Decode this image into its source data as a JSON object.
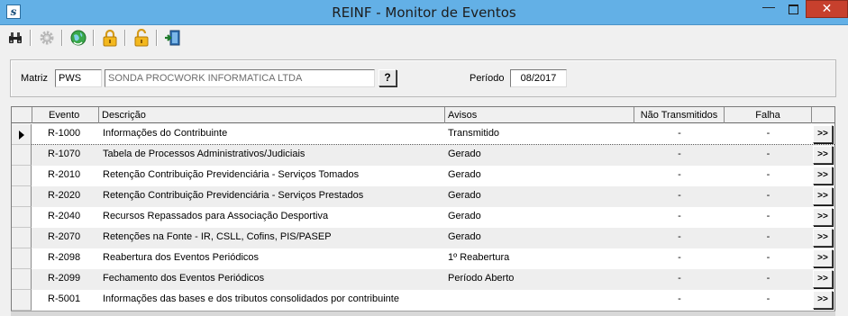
{
  "window": {
    "title": "REINF - Monitor de Eventos",
    "app_icon": "s",
    "close_glyph": "✕"
  },
  "toolbar": {
    "buttons": [
      "binoculars-icon",
      "gear-icon",
      "globe-refresh-icon",
      "lock-icon",
      "unlock-icon",
      "exit-door-icon"
    ]
  },
  "filters": {
    "matriz_label": "Matriz",
    "matriz_code": "PWS",
    "matriz_name": "SONDA PROCWORK INFORMATICA LTDA",
    "lookup_label": "?",
    "periodo_label": "Período",
    "periodo_value": "08/2017"
  },
  "grid": {
    "columns": [
      "Evento",
      "Descrição",
      "Avisos",
      "Não Transmitidos",
      "Falha"
    ],
    "action_label": ">>",
    "rows": [
      {
        "evento": "R-1000",
        "descricao": "Informações do Contribuinte",
        "avisos": "Transmitido",
        "nao_transmitidos": "-",
        "falha": "-"
      },
      {
        "evento": "R-1070",
        "descricao": "Tabela de Processos Administrativos/Judiciais",
        "avisos": "Gerado",
        "nao_transmitidos": "-",
        "falha": "-"
      },
      {
        "evento": "R-2010",
        "descricao": "Retenção Contribuição Previdenciária - Serviços Tomados",
        "avisos": "Gerado",
        "nao_transmitidos": "-",
        "falha": "-"
      },
      {
        "evento": "R-2020",
        "descricao": "Retenção Contribuição Previdenciária - Serviços Prestados",
        "avisos": "Gerado",
        "nao_transmitidos": "-",
        "falha": "-"
      },
      {
        "evento": "R-2040",
        "descricao": "Recursos Repassados para Associação Desportiva",
        "avisos": "Gerado",
        "nao_transmitidos": "-",
        "falha": "-"
      },
      {
        "evento": "R-2070",
        "descricao": "Retenções na Fonte - IR, CSLL, Cofins, PIS/PASEP",
        "avisos": "Gerado",
        "nao_transmitidos": "-",
        "falha": "-"
      },
      {
        "evento": "R-2098",
        "descricao": "Reabertura dos Eventos Periódicos",
        "avisos": "1º Reabertura",
        "nao_transmitidos": "-",
        "falha": "-"
      },
      {
        "evento": "R-2099",
        "descricao": "Fechamento dos Eventos Periódicos",
        "avisos": "Período Aberto",
        "nao_transmitidos": "-",
        "falha": "-"
      },
      {
        "evento": "R-5001",
        "descricao": "Informações das bases e dos tributos consolidados por contribuinte",
        "avisos": "",
        "nao_transmitidos": "-",
        "falha": "-"
      }
    ]
  },
  "colors": {
    "titlebar": "#63b0e6",
    "close": "#c7402d",
    "row_alt": "#eeeeee"
  }
}
